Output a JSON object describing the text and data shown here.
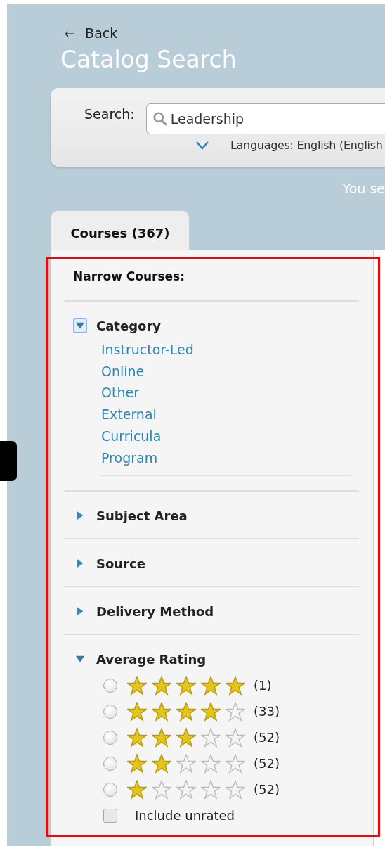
{
  "back_link": {
    "arrow": "←",
    "label": "Back"
  },
  "title": "Catalog Search",
  "search": {
    "label": "Search:",
    "value": "Leadership",
    "languages": "Languages: English (English"
  },
  "notice": "You se",
  "tabs": [
    {
      "label": "Courses (367)",
      "selected": true
    }
  ],
  "narrow": {
    "heading": "Narrow Courses:",
    "sections": [
      {
        "title": "Category",
        "expanded": true,
        "focused": true,
        "kind": "links",
        "items": [
          "Instructor-Led",
          "Online",
          "Other",
          "External",
          "Curricula",
          "Program"
        ]
      },
      {
        "title": "Subject Area",
        "expanded": false,
        "focused": false
      },
      {
        "title": "Source",
        "expanded": false,
        "focused": false
      },
      {
        "title": "Delivery Method",
        "expanded": false,
        "focused": false
      },
      {
        "title": "Average Rating",
        "expanded": true,
        "focused": false,
        "kind": "ratings",
        "ratings": [
          {
            "stars": 5,
            "count": "(1)",
            "selected": false
          },
          {
            "stars": 4,
            "count": "(33)",
            "selected": false
          },
          {
            "stars": 3,
            "count": "(52)",
            "selected": false
          },
          {
            "stars": 2,
            "count": "(52)",
            "selected": false
          },
          {
            "stars": 1,
            "count": "(52)",
            "selected": false
          }
        ],
        "unrated": {
          "label": "Include unrated",
          "checked": false
        }
      }
    ]
  },
  "annotation": {
    "kind": "frame"
  }
}
